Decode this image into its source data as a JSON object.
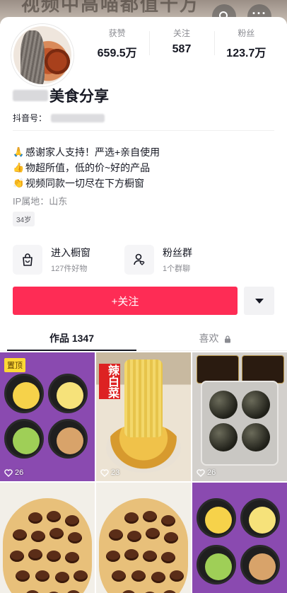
{
  "cover": {
    "text": "视频中高喵都值千万"
  },
  "profile": {
    "nickname": "美食分享",
    "douyin_id_label": "抖音号：",
    "stats": [
      {
        "label": "获赞",
        "value": "659.5万"
      },
      {
        "label": "关注",
        "value": "587"
      },
      {
        "label": "粉丝",
        "value": "123.7万"
      }
    ],
    "bio": [
      {
        "emoji": "🙏",
        "text": "感谢家人支持！严选+亲自使用"
      },
      {
        "emoji": "👍",
        "text": "物超所值，低的价~好的产品"
      },
      {
        "emoji": "👏",
        "text": "视频同款一切尽在下方橱窗"
      }
    ],
    "ip": "IP属地：山东",
    "age_tag": "34岁"
  },
  "entries": {
    "shop": {
      "title": "进入橱窗",
      "subtitle": "127件好物"
    },
    "fans": {
      "title": "粉丝群",
      "subtitle": "1个群聊"
    }
  },
  "actions": {
    "follow": "+关注"
  },
  "tabs": {
    "works": "作品 1347",
    "likes": "喜欢"
  },
  "videos": [
    {
      "likes": "26",
      "pinned": "置顶"
    },
    {
      "likes": "23"
    },
    {
      "likes": "26"
    },
    {
      "likes": ""
    },
    {
      "likes": ""
    },
    {
      "likes": ""
    }
  ],
  "colors": {
    "accent": "#fe2c55",
    "text": "#161823",
    "muted": "#8a8b91"
  }
}
